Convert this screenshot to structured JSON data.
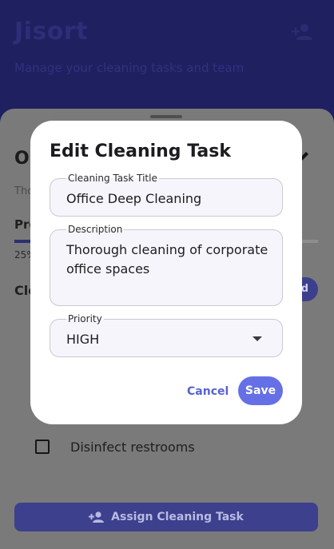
{
  "app": {
    "brand": "Jisort",
    "subtitle": "Manage your cleaning tasks and team",
    "add_member_icon": "person-add-icon"
  },
  "sheet": {
    "title_partial": "O",
    "description_partial": "Tho",
    "progress_label_partial": "Pro",
    "progress_text_partial": "25%",
    "progress_value": 0.25,
    "cleaning_label_partial": "Cle",
    "add_button_partial": "d",
    "tasks": [
      {
        "label": "Disinfect restrooms",
        "checked": false
      }
    ],
    "assign_button": "Assign Cleaning Task"
  },
  "dialog": {
    "title": "Edit Cleaning Task",
    "fields": {
      "title": {
        "label": "Cleaning Task Title",
        "value": "Office Deep Cleaning"
      },
      "description": {
        "label": "Description",
        "value": "Thorough cleaning of corporate office spaces"
      },
      "priority": {
        "label": "Priority",
        "value": "HIGH"
      }
    },
    "cancel": "Cancel",
    "save": "Save"
  },
  "colors": {
    "accent": "#6570e6",
    "scrim": "#5b5b5b",
    "header": "#1f2060"
  }
}
